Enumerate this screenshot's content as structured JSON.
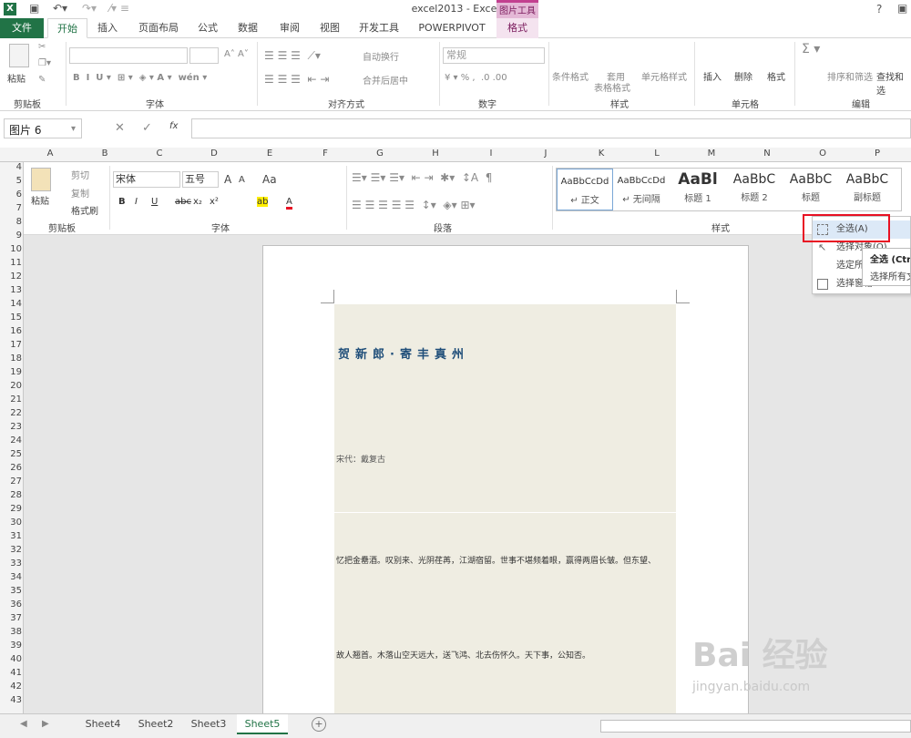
{
  "window": {
    "title": "excel2013 - Excel",
    "context_tool": "图片工具",
    "help": "?"
  },
  "tabs": [
    "文件",
    "开始",
    "插入",
    "页面布局",
    "公式",
    "数据",
    "审阅",
    "视图",
    "开发工具",
    "POWERPIVOT",
    "格式"
  ],
  "ribbon": {
    "clipboard": {
      "paste": "粘贴",
      "label": "剪贴板"
    },
    "font": {
      "label": "字体"
    },
    "align": {
      "wrap": "自动换行",
      "merge": "合并后居中",
      "label": "对齐方式"
    },
    "number": {
      "format": "常规",
      "label": "数字"
    },
    "styles": {
      "cond": "条件格式",
      "table": "套用",
      "table2": "表格格式",
      "cell": "单元格样式",
      "label": "样式"
    },
    "cells": {
      "insert": "插入",
      "delete": "删除",
      "format": "格式",
      "label": "单元格"
    },
    "edit": {
      "sort": "排序和筛选",
      "find": "查找和选",
      "label": "编辑"
    }
  },
  "formula_bar": {
    "name_box": "图片 6",
    "fx": "fx",
    "value": ""
  },
  "columns": [
    "A",
    "B",
    "C",
    "D",
    "E",
    "F",
    "G",
    "H",
    "I",
    "J",
    "K",
    "L",
    "M",
    "N",
    "O",
    "P"
  ],
  "rows": [
    "4",
    "5",
    "6",
    "7",
    "8",
    "9",
    "10",
    "11",
    "12",
    "13",
    "14",
    "15",
    "16",
    "17",
    "18",
    "19",
    "20",
    "21",
    "22",
    "23",
    "24",
    "25",
    "26",
    "27",
    "28",
    "29",
    "30",
    "31",
    "32",
    "33",
    "34",
    "35",
    "36",
    "37",
    "38",
    "39",
    "40",
    "41",
    "42",
    "43"
  ],
  "word_ribbon": {
    "clipboard": {
      "cut": "剪切",
      "copy": "复制",
      "painter": "格式刷",
      "paste": "粘贴",
      "label": "剪贴板"
    },
    "font": {
      "name": "宋体",
      "size": "五号",
      "label": "字体",
      "bold": "B",
      "italic": "I",
      "underline": "U",
      "strike": "abc",
      "sub": "x₂",
      "sup": "x²",
      "grow": "A",
      "shrink": "A",
      "case": "Aa",
      "font_color": "A",
      "highlight": "ab"
    },
    "paragraph": {
      "label": "段落"
    },
    "styles": {
      "label": "样式",
      "items": [
        {
          "sample": "AaBbCcDd",
          "name": "↵ 正文"
        },
        {
          "sample": "AaBbCcDd",
          "name": "↵ 无间隔"
        },
        {
          "sample": "AaBl",
          "name": "标题 1"
        },
        {
          "sample": "AaBbC",
          "name": "标题 2"
        },
        {
          "sample": "AaBbC",
          "name": "标题"
        },
        {
          "sample": "AaBbC",
          "name": "副标题"
        }
      ]
    }
  },
  "document": {
    "title": "贺新郎·寄丰真州",
    "author": "宋代：戴复古",
    "line1": "忆把金罍酒。叹别来、光阴荏苒，江湖宿留。世事不堪频着眼，赢得两眉长皱。但东望、",
    "line2": "故人翘首。木落山空天远大，送飞鸿、北去伤怀久。天下事，公知否。"
  },
  "context_menu": {
    "items": [
      "全选(A)",
      "选择对象(O)",
      "选定所有",
      "选择窗格"
    ]
  },
  "tooltip": {
    "title": "全选 (Ctrl",
    "desc": "选择所有文"
  },
  "sheets": [
    "Sheet4",
    "Sheet2",
    "Sheet3",
    "Sheet5"
  ],
  "active_sheet": "Sheet5",
  "watermark": {
    "brand": "Bai 经验",
    "url": "jingyan.baidu.com"
  },
  "colors": {
    "excel_green": "#217346",
    "highlight_red": "#e81123",
    "doc_band": "#efede2"
  }
}
